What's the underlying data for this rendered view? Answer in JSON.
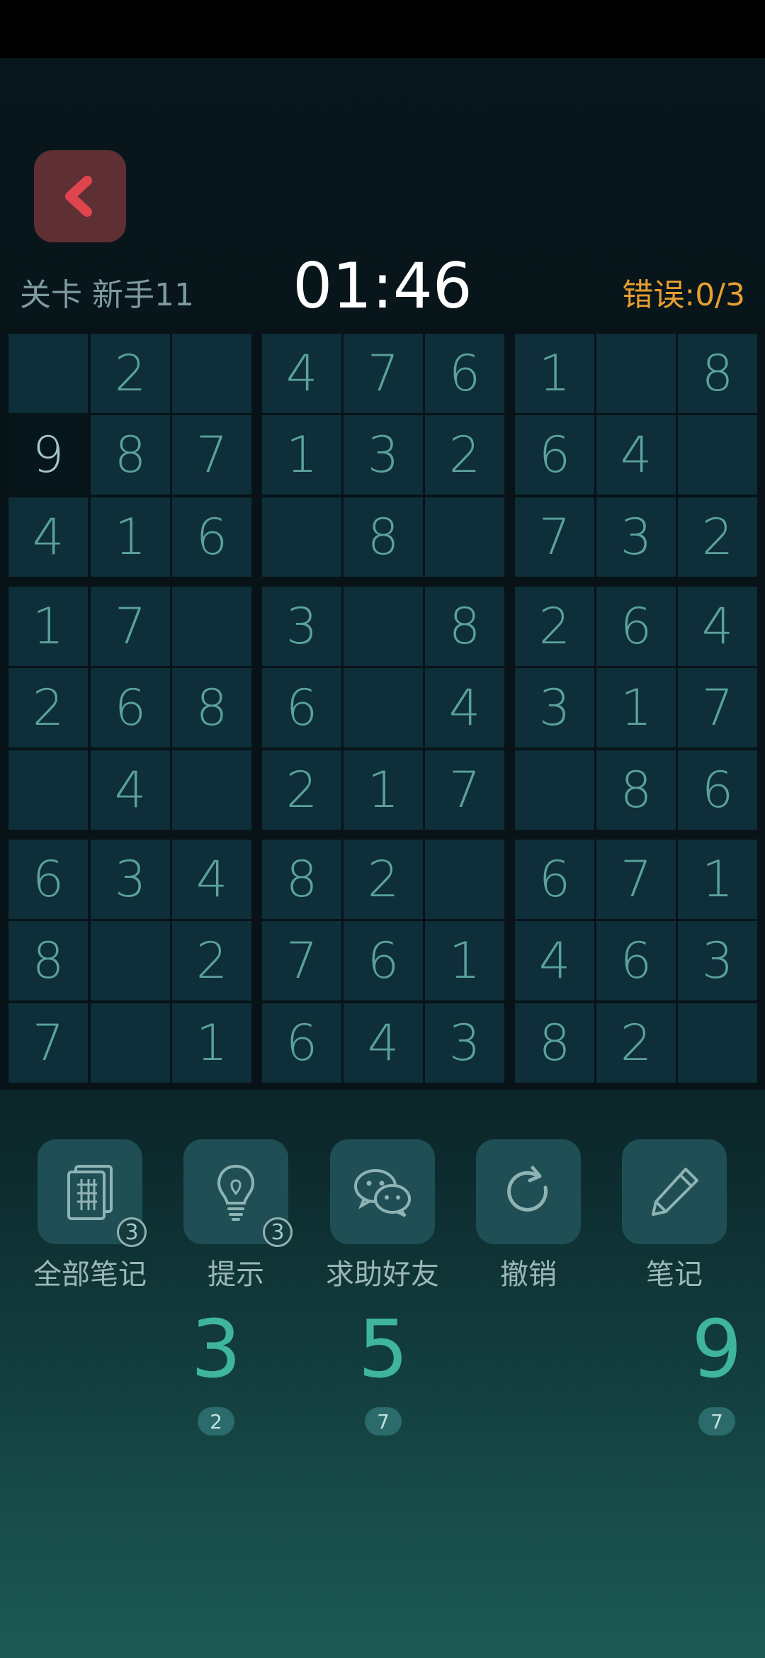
{
  "header": {
    "level_label": "关卡",
    "level_name": "新手11",
    "timer": "01:46",
    "errors_label": "错误:",
    "errors_value": "0/3"
  },
  "board": [
    [
      "",
      "2",
      "",
      "4",
      "7",
      "6",
      "1",
      "",
      "8"
    ],
    [
      "9",
      "8",
      "7",
      "1",
      "3",
      "2",
      "6",
      "4",
      ""
    ],
    [
      "4",
      "1",
      "6",
      "",
      "8",
      "",
      "7",
      "3",
      "2"
    ],
    [
      "1",
      "7",
      "",
      "3",
      "",
      "8",
      "2",
      "6",
      "4"
    ],
    [
      "2",
      "6",
      "8",
      "6",
      "",
      "4",
      "3",
      "1",
      "7"
    ],
    [
      "",
      "4",
      "",
      "2",
      "1",
      "7",
      "",
      "8",
      "6"
    ],
    [
      "6",
      "3",
      "4",
      "8",
      "2",
      "",
      "6",
      "7",
      "1"
    ],
    [
      "8",
      "",
      "2",
      "7",
      "6",
      "1",
      "4",
      "6",
      "3"
    ],
    [
      "7",
      "",
      "1",
      "6",
      "4",
      "3",
      "8",
      "2",
      ""
    ]
  ],
  "selected_cell": {
    "row": 1,
    "col": 0
  },
  "tools": [
    {
      "label": "全部笔记",
      "icon": "notes-document-icon",
      "badge": "3"
    },
    {
      "label": "提示",
      "icon": "lightbulb-icon",
      "badge": "3"
    },
    {
      "label": "求助好友",
      "icon": "wechat-icon",
      "badge": ""
    },
    {
      "label": "撤销",
      "icon": "undo-icon",
      "badge": ""
    },
    {
      "label": "笔记",
      "icon": "pencil-icon",
      "badge": ""
    }
  ],
  "number_pad": [
    {
      "digit": "3",
      "remaining": "2"
    },
    {
      "digit": "5",
      "remaining": "7"
    },
    {
      "digit": "9",
      "remaining": "7"
    }
  ],
  "colors": {
    "accent": "#3fb49f",
    "error": "#e79e31",
    "back_button": "#5e2f33",
    "cell": "#0e2e39"
  }
}
